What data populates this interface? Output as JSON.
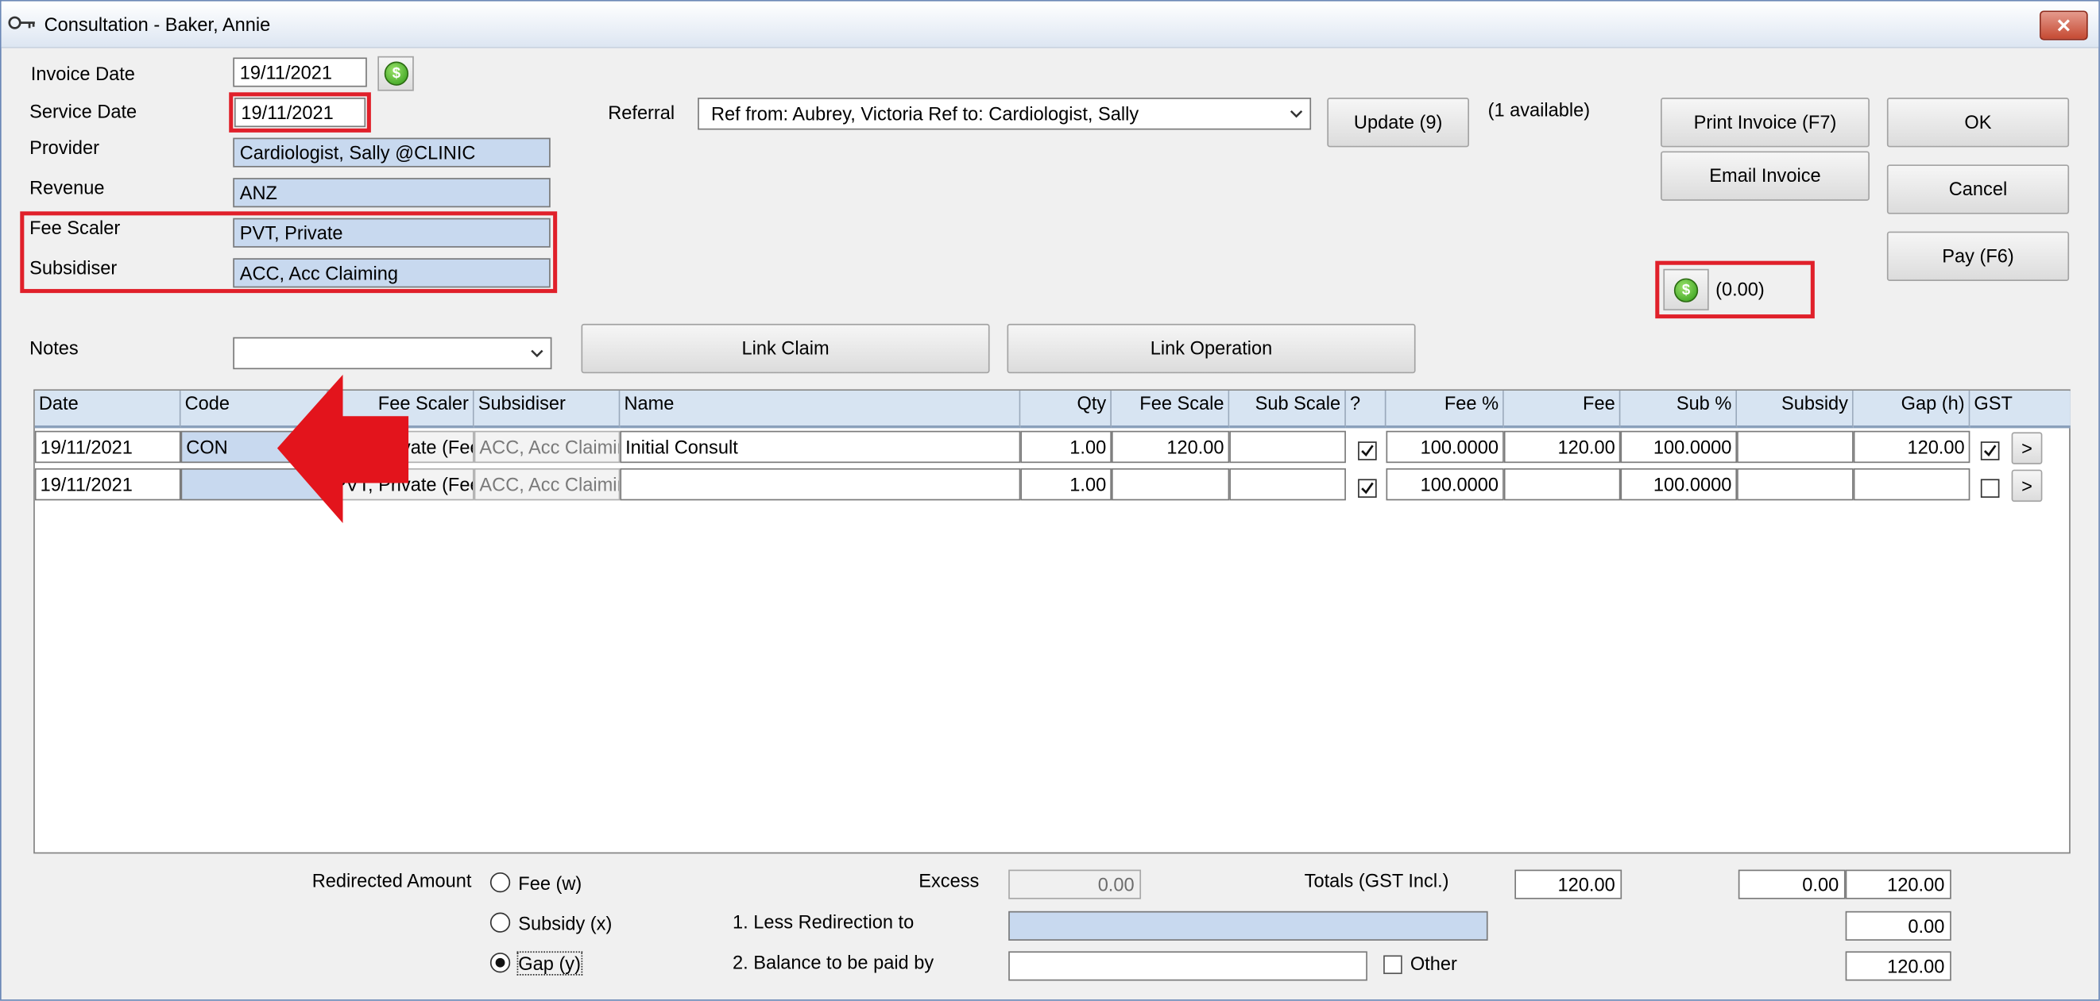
{
  "window": {
    "title": "Consultation - Baker, Annie",
    "close_glyph": "✕"
  },
  "form": {
    "invoice_date": {
      "label": "Invoice Date",
      "value": "19/11/2021"
    },
    "service_date": {
      "label": "Service Date",
      "value": "19/11/2021"
    },
    "provider": {
      "label": "Provider",
      "value": "Cardiologist, Sally @CLINIC"
    },
    "revenue": {
      "label": "Revenue",
      "value": "ANZ"
    },
    "fee_scaler": {
      "label": "Fee Scaler",
      "value": "PVT, Private"
    },
    "subsidiser": {
      "label": "Subsidiser",
      "value": "ACC, Acc Claiming"
    },
    "notes": {
      "label": "Notes",
      "value": ""
    },
    "referral": {
      "label": "Referral",
      "value": "Ref from: Aubrey, Victoria Ref to: Cardiologist, Sally"
    },
    "available_text": "(1 available)",
    "balance_text": "(0.00)"
  },
  "buttons": {
    "update": "Update (9)",
    "print_invoice": "Print Invoice (F7)",
    "email_invoice": "Email Invoice",
    "ok": "OK",
    "cancel": "Cancel",
    "pay": "Pay (F6)",
    "link_claim": "Link Claim",
    "link_operation": "Link Operation",
    "row_expand": ">"
  },
  "grid": {
    "columns": [
      "Date",
      "Code",
      "Fee Scaler",
      "Subsidiser",
      "Name",
      "Qty",
      "Fee Scale",
      "Sub Scale",
      "?",
      "Fee %",
      "Fee",
      "Sub %",
      "Subsidy",
      "Gap (h)",
      "GST"
    ],
    "rows": [
      {
        "date": "19/11/2021",
        "code": "CON",
        "fee_scaler": "PVT, Private (Fee",
        "subsidiser": "ACC, Acc Claimin",
        "name": "Initial Consult",
        "qty": "1.00",
        "fee_scale": "120.00",
        "sub_scale": "",
        "q_checked": true,
        "fee_pct": "100.0000",
        "fee": "120.00",
        "sub_pct": "100.0000",
        "subsidy": "",
        "gap": "120.00",
        "gst_checked": true
      },
      {
        "date": "19/11/2021",
        "code": "",
        "fee_scaler": "PVT, Private (Fee",
        "subsidiser": "ACC, Acc Claimin",
        "name": "",
        "qty": "1.00",
        "fee_scale": "",
        "sub_scale": "",
        "q_checked": true,
        "fee_pct": "100.0000",
        "fee": "",
        "sub_pct": "100.0000",
        "subsidy": "",
        "gap": "",
        "gst_checked": false
      }
    ]
  },
  "footer": {
    "redirected_amount_label": "Redirected Amount",
    "radio_fee": "Fee (w)",
    "radio_subsidy": "Subsidy (x)",
    "radio_gap": "Gap (y)",
    "radio_selected": "gap",
    "excess_label": "Excess",
    "excess_value": "0.00",
    "less_redirection_label": "1. Less Redirection to",
    "balance_paid_by_label": "2. Balance to be paid by",
    "other_label": "Other",
    "totals_label": "Totals (GST Incl.)",
    "total_fee": "120.00",
    "total_subsidy": "0.00",
    "total_gap": "120.00",
    "less_redirection_value": "0.00",
    "balance_value": "120.00"
  },
  "annotation": {
    "highlight_color": "#e0202a",
    "arrow_color": "#e3141c"
  }
}
